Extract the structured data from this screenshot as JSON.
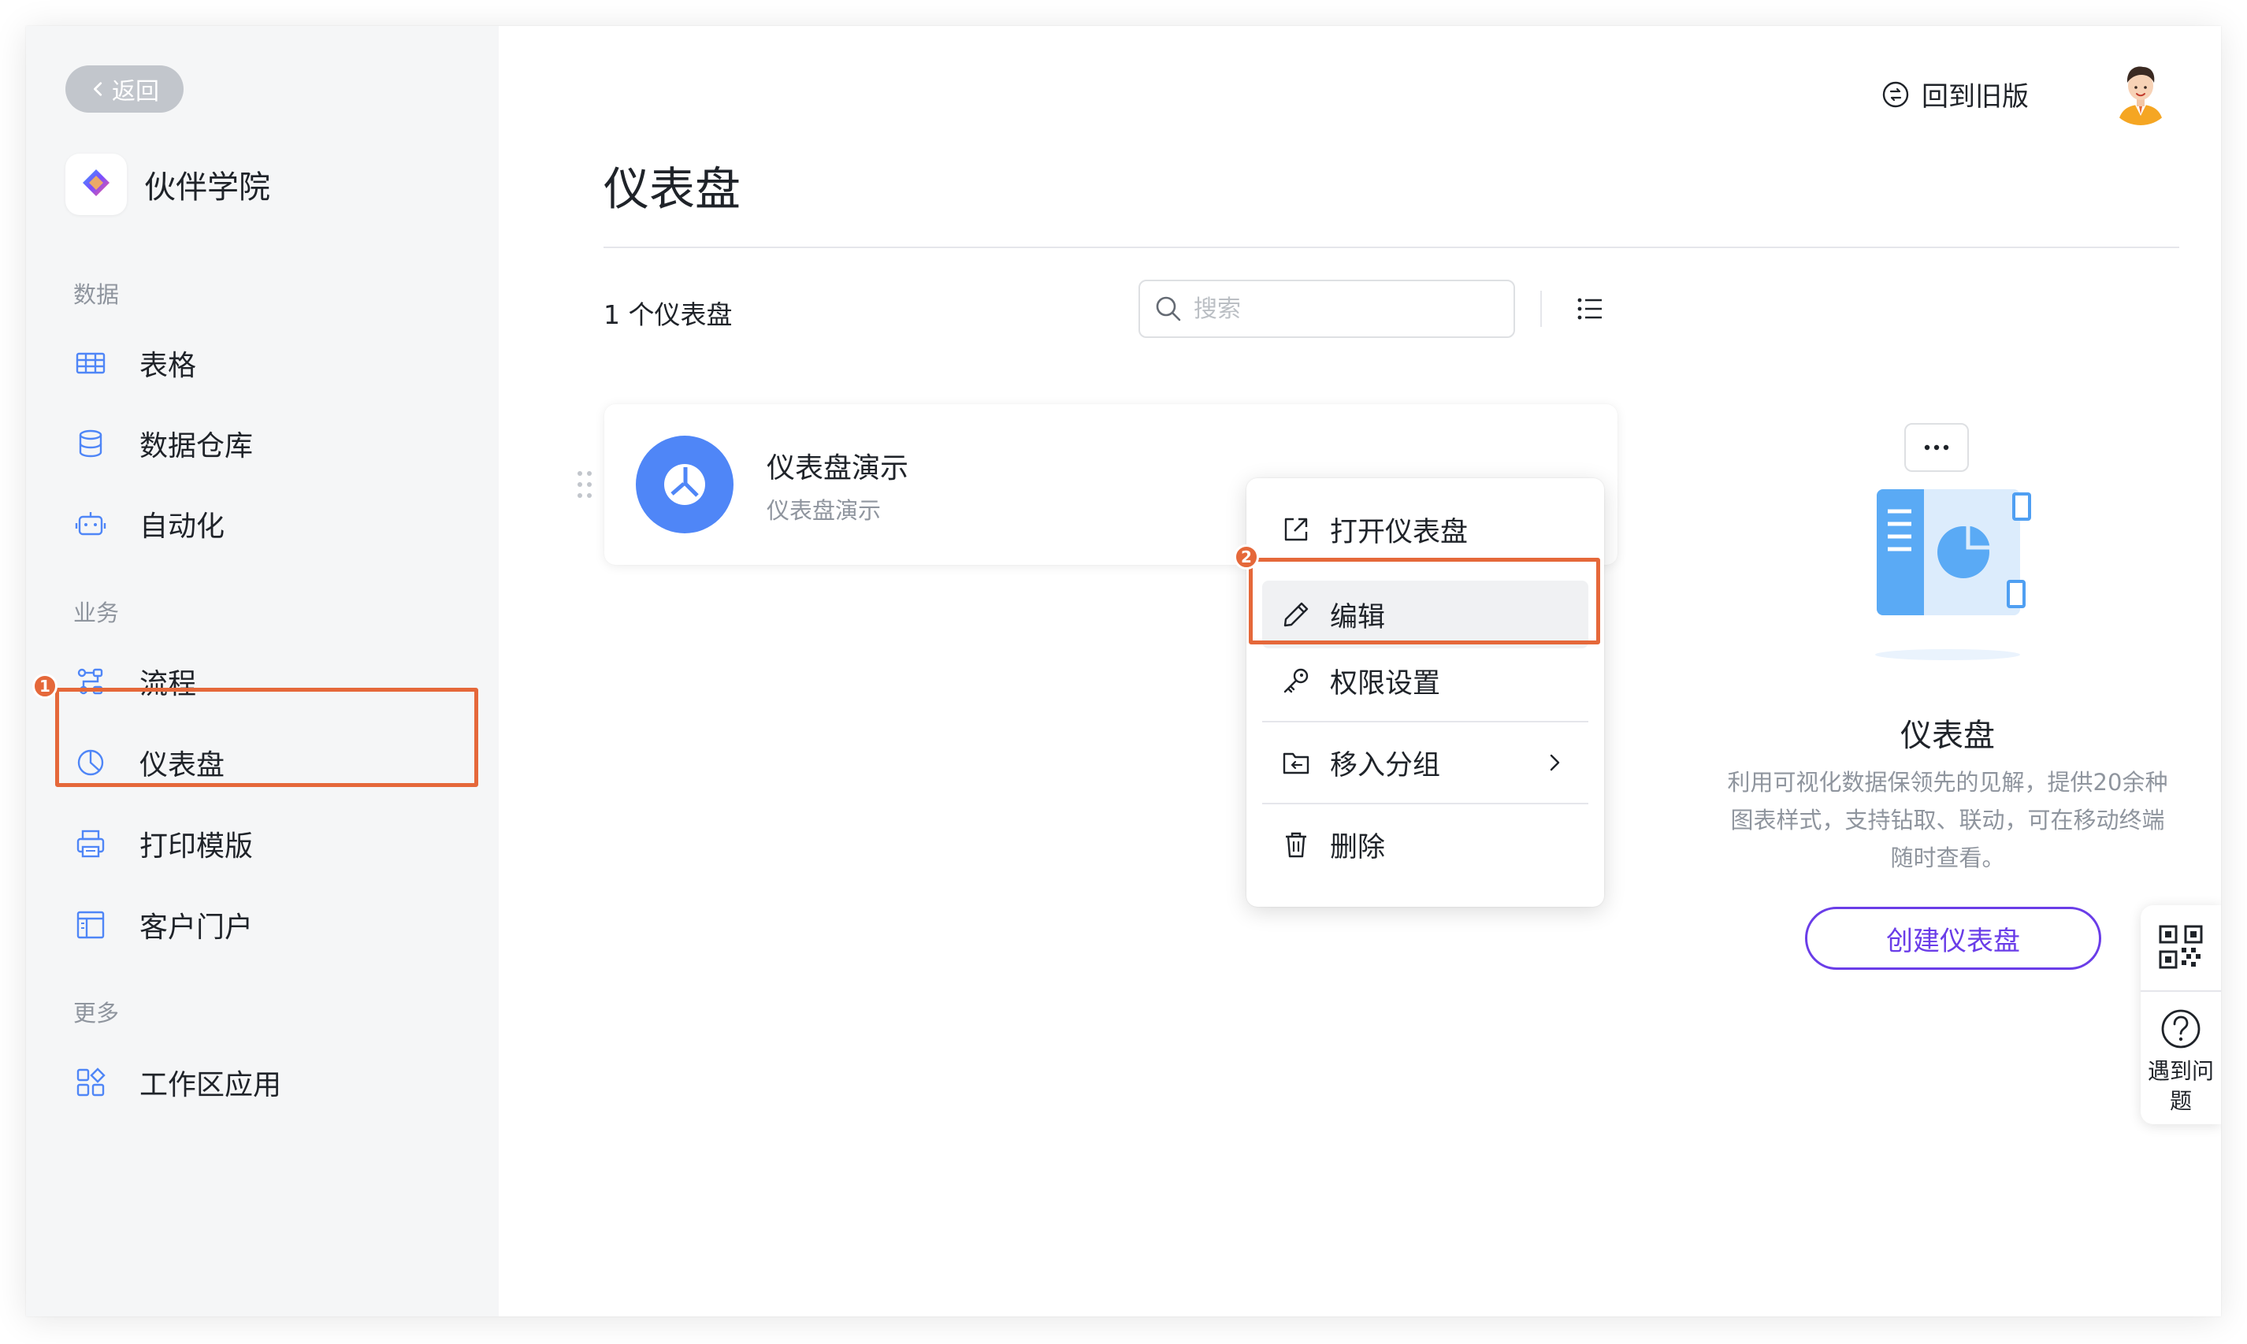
{
  "sidebar": {
    "back_label": "返回",
    "app_name": "伙伴学院",
    "sections": {
      "data": "数据",
      "business": "业务",
      "more": "更多"
    },
    "items": {
      "table": "表格",
      "warehouse": "数据仓库",
      "automation": "自动化",
      "flow": "流程",
      "dashboard": "仪表盘",
      "print_template": "打印模版",
      "portal": "客户门户",
      "workspace_apps": "工作区应用"
    }
  },
  "header": {
    "old_version_label": "回到旧版"
  },
  "main": {
    "title": "仪表盘",
    "count_text": "1 个仪表盘",
    "search_placeholder": "搜索"
  },
  "card": {
    "name": "仪表盘演示",
    "description": "仪表盘演示"
  },
  "menu": {
    "open": "打开仪表盘",
    "edit": "编辑",
    "permissions": "权限设置",
    "move_group": "移入分组",
    "delete": "删除"
  },
  "promo": {
    "title": "仪表盘",
    "description": "利用可视化数据保领先的见解，提供20余种图表样式，支持钻取、联动，可在移动终端随时查看。",
    "create_button": "创建仪表盘"
  },
  "float_widget": {
    "help_text": "遇到问题"
  },
  "annotations": {
    "step1": "1",
    "step2": "2"
  },
  "colors": {
    "highlight": "#e5683a",
    "accent_purple": "#6a3de8",
    "icon_blue": "#4f86f7",
    "sidebar_bg": "#f5f6f7"
  }
}
